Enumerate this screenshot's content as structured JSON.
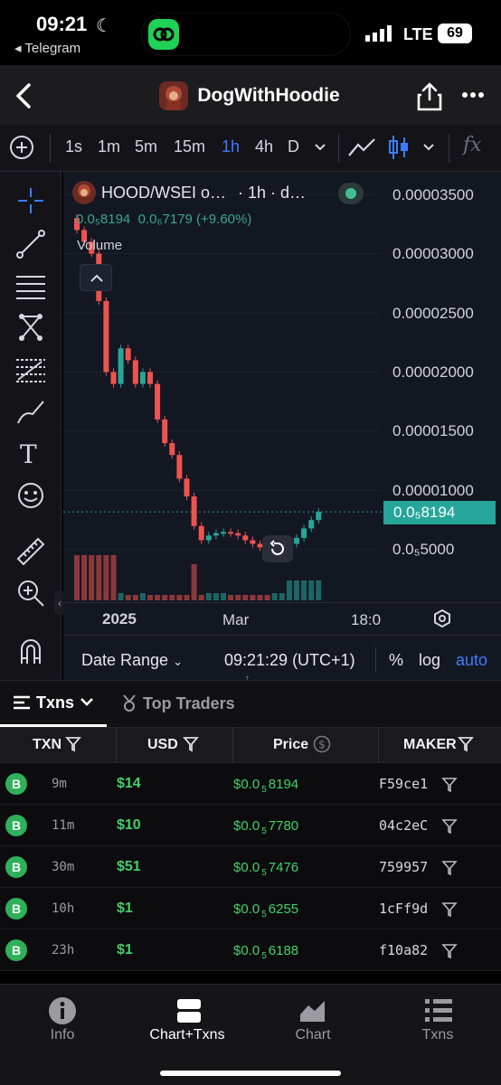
{
  "status_bar": {
    "time": "09:21",
    "back_app": "◂ Telegram",
    "network": "LTE",
    "battery": "69"
  },
  "header": {
    "title": "DogWithHoodie"
  },
  "timeframes": [
    "1s",
    "1m",
    "5m",
    "15m",
    "1h",
    "4h",
    "D"
  ],
  "active_timeframe": "1h",
  "chart": {
    "symbol": "HOOD/WSEI o…",
    "interval": "· 1h · d…",
    "ohlc_last": "0.0₅8194",
    "ohlc_change": "0.0₆7179 (+9.60%)",
    "volume_label": "Volume",
    "price_axis": [
      "0.00003500",
      "0.00003000",
      "0.00002500",
      "0.00002000",
      "0.00001500",
      "0.00001000",
      "0.0₅5000"
    ],
    "current_price_label": "0.0₅8194",
    "time_axis": [
      "2025",
      "Mar",
      "18:0"
    ],
    "date_range_label": "Date Range",
    "clock": "09:21:29 (UTC+1)",
    "percent_label": "%",
    "log_label": "log",
    "auto_label": "auto"
  },
  "chart_data": {
    "type": "candlestick",
    "price_unit": "WSEI",
    "candles_approx_close": [
      3.2e-05,
      3.1e-05,
      3e-05,
      2.6e-05,
      2e-05,
      1.9e-05,
      2.2e-05,
      2.1e-05,
      1.9e-05,
      2e-05,
      1.9e-05,
      1.6e-05,
      1.4e-05,
      1.3e-05,
      1.1e-05,
      9.5e-06,
      7e-06,
      5.8e-06,
      6.2e-06,
      6.4e-06,
      6.5e-06,
      6.4e-06,
      6.2e-06,
      5.8e-06,
      5.5e-06,
      5.2e-06,
      5e-06,
      5e-06,
      5.2e-06,
      5.5e-06,
      6e-06,
      6.8e-06,
      7.5e-06,
      8.2e-06
    ],
    "last_price": "0.0₅8194",
    "change": "+9.60%"
  },
  "tabs": {
    "txns": "Txns",
    "top_traders": "Top Traders"
  },
  "table": {
    "headers": [
      "TXN",
      "USD",
      "Price",
      "MAKER"
    ],
    "rows": [
      {
        "side": "B",
        "age": "9m",
        "usd": "$14",
        "price_prefix": "$0.0",
        "price_sub": "5",
        "price_rest": "8194",
        "maker": "F59ce1"
      },
      {
        "side": "B",
        "age": "11m",
        "usd": "$10",
        "price_prefix": "$0.0",
        "price_sub": "5",
        "price_rest": "7780",
        "maker": "04c2eC"
      },
      {
        "side": "B",
        "age": "30m",
        "usd": "$51",
        "price_prefix": "$0.0",
        "price_sub": "5",
        "price_rest": "7476",
        "maker": "759957"
      },
      {
        "side": "B",
        "age": "10h",
        "usd": "$1",
        "price_prefix": "$0.0",
        "price_sub": "5",
        "price_rest": "6255",
        "maker": "1cFf9d"
      },
      {
        "side": "B",
        "age": "23h",
        "usd": "$1",
        "price_prefix": "$0.0",
        "price_sub": "5",
        "price_rest": "6188",
        "maker": "f10a82"
      }
    ]
  },
  "bottom_nav": [
    {
      "label": "Info",
      "icon": "info-icon"
    },
    {
      "label": "Chart+Txns",
      "icon": "split-view-icon",
      "active": true
    },
    {
      "label": "Chart",
      "icon": "area-chart-icon"
    },
    {
      "label": "Txns",
      "icon": "list-icon"
    }
  ],
  "colors": {
    "up": "#26a69a",
    "down": "#ef5350",
    "accent": "#2962ff",
    "buy": "#2fb05a"
  }
}
